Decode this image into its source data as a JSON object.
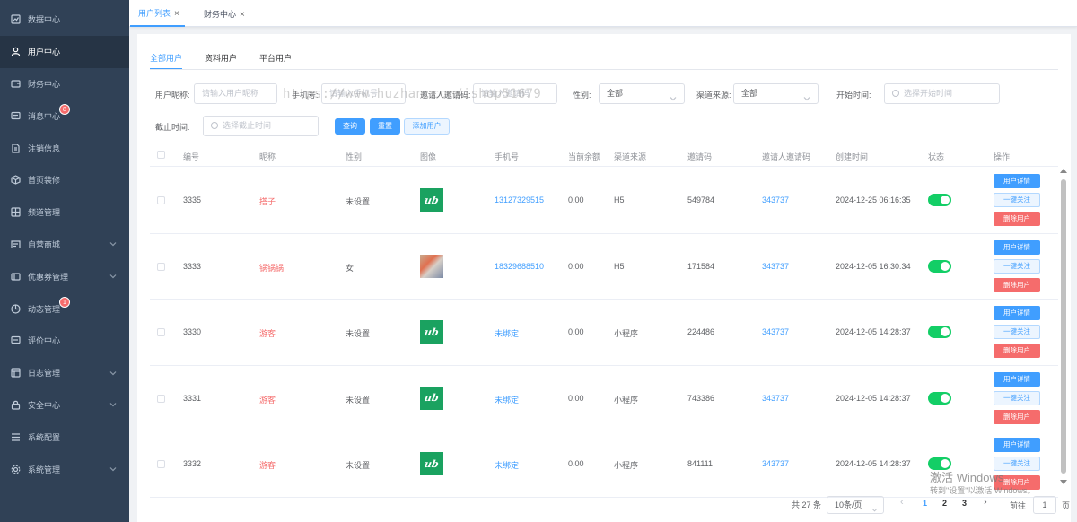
{
  "sidebar": {
    "items": [
      {
        "label": "数据中心",
        "icon": "chart-icon"
      },
      {
        "label": "用户中心",
        "icon": "user-icon"
      },
      {
        "label": "财务中心",
        "icon": "wallet-icon"
      },
      {
        "label": "消息中心",
        "icon": "message-icon",
        "badge": "8"
      },
      {
        "label": "注销信息",
        "icon": "document-icon"
      },
      {
        "label": "首页装修",
        "icon": "cube-icon"
      },
      {
        "label": "频道管理",
        "icon": "grid-icon"
      },
      {
        "label": "自营商城",
        "icon": "shop-icon"
      },
      {
        "label": "优惠券管理",
        "icon": "coupon-icon"
      },
      {
        "label": "动态管理",
        "icon": "pie-icon",
        "badge": "1"
      },
      {
        "label": "评价中心",
        "icon": "comment-icon"
      },
      {
        "label": "日志管理",
        "icon": "log-icon"
      },
      {
        "label": "安全中心",
        "icon": "lock-icon"
      },
      {
        "label": "系统配置",
        "icon": "list-icon"
      },
      {
        "label": "系统管理",
        "icon": "gear-icon"
      }
    ]
  },
  "page_tabs": [
    {
      "label": "用户列表"
    },
    {
      "label": "财务中心"
    }
  ],
  "sub_tabs": [
    "全部用户",
    "资料用户",
    "平台用户"
  ],
  "filters": {
    "nickname_label": "用户昵称:",
    "nickname_placeholder": "请输入用户昵称",
    "phone_label": "手机号:",
    "phone_placeholder": "请输入手机号",
    "inviter_label": "邀请人邀请码:",
    "inviter_placeholder": "请输入邀请码",
    "gender_label": "性别:",
    "gender_value": "全部",
    "channel_label": "渠道来源:",
    "channel_value": "全部",
    "start_label": "开始时间:",
    "start_placeholder": "选择开始时间",
    "end_label": "截止时间:",
    "end_placeholder": "选择截止时间"
  },
  "buttons": {
    "search": "查询",
    "reset": "重置",
    "add_user": "添加用户"
  },
  "table": {
    "headers": [
      "编号",
      "昵称",
      "性别",
      "图像",
      "手机号",
      "当前余额",
      "渠道来源",
      "邀请码",
      "邀请人邀请码",
      "创建时间",
      "状态",
      "操作"
    ],
    "rows": [
      {
        "id": "3335",
        "nickname": "搭子",
        "gender": "未设置",
        "avatar": "logo",
        "phone": "13127329515",
        "balance": "0.00",
        "channel": "H5",
        "invite_code": "549784",
        "inviter_code": "343737",
        "created": "2024-12-25 06:16:35"
      },
      {
        "id": "3333",
        "nickname": "锅锅锅",
        "gender": "女",
        "avatar": "photo",
        "phone": "18329688510",
        "balance": "0.00",
        "channel": "H5",
        "invite_code": "171584",
        "inviter_code": "343737",
        "created": "2024-12-05 16:30:34"
      },
      {
        "id": "3330",
        "nickname": "游客",
        "gender": "未设置",
        "avatar": "logo",
        "phone": "未绑定",
        "balance": "0.00",
        "channel": "小程序",
        "invite_code": "224486",
        "inviter_code": "343737",
        "created": "2024-12-05 14:28:37"
      },
      {
        "id": "3331",
        "nickname": "游客",
        "gender": "未设置",
        "avatar": "logo",
        "phone": "未绑定",
        "balance": "0.00",
        "channel": "小程序",
        "invite_code": "743386",
        "inviter_code": "343737",
        "created": "2024-12-05 14:28:37"
      },
      {
        "id": "3332",
        "nickname": "游客",
        "gender": "未设置",
        "avatar": "logo",
        "phone": "未绑定",
        "balance": "0.00",
        "channel": "小程序",
        "invite_code": "841111",
        "inviter_code": "343737",
        "created": "2024-12-05 14:28:37"
      }
    ],
    "op_detail": "用户详情",
    "op_follow": "一键关注",
    "op_delete": "删除用户",
    "avatar_logo_text": "ub"
  },
  "pagination": {
    "total": "共 27 条",
    "page_size": "10条/页",
    "pages": [
      "1",
      "2",
      "3"
    ],
    "prev": "‹",
    "next": "›",
    "goto_label": "前往",
    "goto_value": "1",
    "page_suffix": "页"
  },
  "watermark": "https://www.huzhan.com/ishop51679",
  "windows_activation": {
    "title": "激活 Windows",
    "subtitle": "转到\"设置\"以激活 Windows。"
  },
  "colors": {
    "sidebar_bg": "#304156",
    "primary": "#409eff",
    "danger": "#f56c6c",
    "success": "#13ce66"
  }
}
